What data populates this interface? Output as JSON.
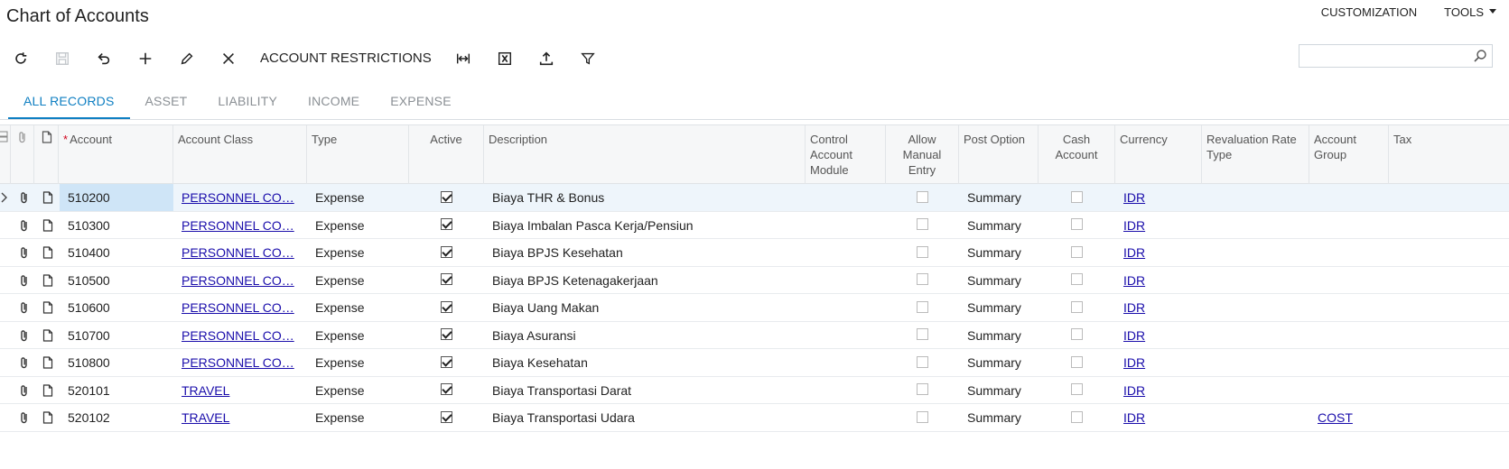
{
  "page": {
    "title": "Chart of Accounts"
  },
  "top_menu": {
    "customization": "CUSTOMIZATION",
    "tools": "TOOLS"
  },
  "toolbar": {
    "account_restrictions": "ACCOUNT RESTRICTIONS",
    "search_placeholder": ""
  },
  "tabs": [
    {
      "label": "ALL RECORDS",
      "active": true
    },
    {
      "label": "ASSET",
      "active": false
    },
    {
      "label": "LIABILITY",
      "active": false
    },
    {
      "label": "INCOME",
      "active": false
    },
    {
      "label": "EXPENSE",
      "active": false
    }
  ],
  "columns": {
    "account": "Account",
    "account_class": "Account Class",
    "type": "Type",
    "active": "Active",
    "description": "Description",
    "control_account_module": "Control Account Module",
    "allow_manual_entry": "Allow Manual Entry",
    "post_option": "Post Option",
    "cash_account": "Cash Account",
    "currency": "Currency",
    "revaluation_rate_type": "Revaluation Rate Type",
    "account_group": "Account Group",
    "tax": "Tax"
  },
  "rows": [
    {
      "account": "510200",
      "account_class": "PERSONNEL CO…",
      "type": "Expense",
      "active": true,
      "description": "Biaya THR & Bonus",
      "allow_manual": false,
      "post_option": "Summary",
      "cash_account": false,
      "currency": "IDR",
      "account_group": ""
    },
    {
      "account": "510300",
      "account_class": "PERSONNEL CO…",
      "type": "Expense",
      "active": true,
      "description": "Biaya Imbalan Pasca Kerja/Pensiun",
      "allow_manual": false,
      "post_option": "Summary",
      "cash_account": false,
      "currency": "IDR",
      "account_group": ""
    },
    {
      "account": "510400",
      "account_class": "PERSONNEL CO…",
      "type": "Expense",
      "active": true,
      "description": "Biaya BPJS Kesehatan",
      "allow_manual": false,
      "post_option": "Summary",
      "cash_account": false,
      "currency": "IDR",
      "account_group": ""
    },
    {
      "account": "510500",
      "account_class": "PERSONNEL CO…",
      "type": "Expense",
      "active": true,
      "description": "Biaya BPJS Ketenagakerjaan",
      "allow_manual": false,
      "post_option": "Summary",
      "cash_account": false,
      "currency": "IDR",
      "account_group": ""
    },
    {
      "account": "510600",
      "account_class": "PERSONNEL CO…",
      "type": "Expense",
      "active": true,
      "description": "Biaya Uang Makan",
      "allow_manual": false,
      "post_option": "Summary",
      "cash_account": false,
      "currency": "IDR",
      "account_group": ""
    },
    {
      "account": "510700",
      "account_class": "PERSONNEL CO…",
      "type": "Expense",
      "active": true,
      "description": "Biaya Asuransi",
      "allow_manual": false,
      "post_option": "Summary",
      "cash_account": false,
      "currency": "IDR",
      "account_group": ""
    },
    {
      "account": "510800",
      "account_class": "PERSONNEL CO…",
      "type": "Expense",
      "active": true,
      "description": "Biaya Kesehatan",
      "allow_manual": false,
      "post_option": "Summary",
      "cash_account": false,
      "currency": "IDR",
      "account_group": ""
    },
    {
      "account": "520101",
      "account_class": "TRAVEL",
      "type": "Expense",
      "active": true,
      "description": "Biaya Transportasi Darat",
      "allow_manual": false,
      "post_option": "Summary",
      "cash_account": false,
      "currency": "IDR",
      "account_group": ""
    },
    {
      "account": "520102",
      "account_class": "TRAVEL",
      "type": "Expense",
      "active": true,
      "description": "Biaya Transportasi Udara",
      "allow_manual": false,
      "post_option": "Summary",
      "cash_account": false,
      "currency": "IDR",
      "account_group": "COST"
    }
  ],
  "colors": {
    "accent": "#0f7fc2",
    "link": "#1a0dab",
    "selected_row": "#eef5fb",
    "selected_cell": "#cfe5f7"
  }
}
